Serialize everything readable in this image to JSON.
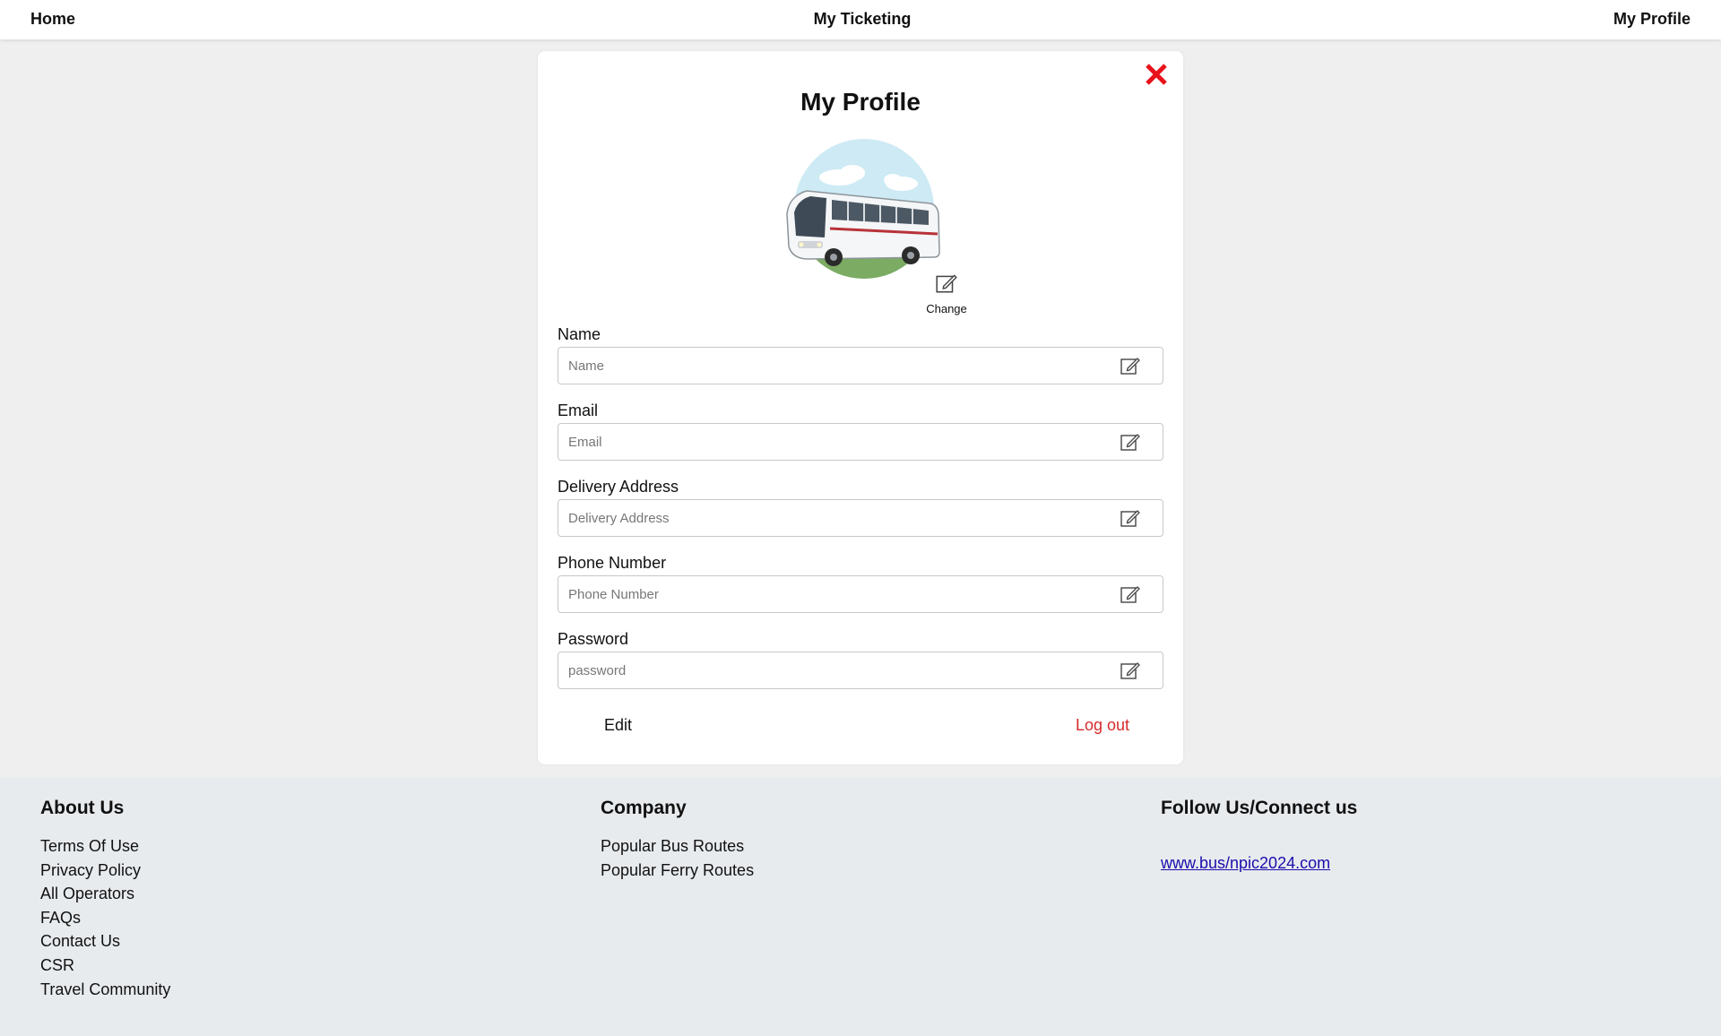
{
  "nav": {
    "home": "Home",
    "ticketing": "My Ticketing",
    "profile": "My Profile"
  },
  "card": {
    "title": "My Profile",
    "change_label": "Change",
    "fields": [
      {
        "label": "Name",
        "placeholder": "Name",
        "value": ""
      },
      {
        "label": "Email",
        "placeholder": "Email",
        "value": ""
      },
      {
        "label": "Delivery Address",
        "placeholder": "Delivery Address",
        "value": ""
      },
      {
        "label": "Phone Number",
        "placeholder": "Phone Number",
        "value": ""
      },
      {
        "label": "Password",
        "placeholder": "password",
        "value": ""
      }
    ],
    "edit_label": "Edit",
    "logout_label": "Log out"
  },
  "footer": {
    "about": {
      "heading": "About Us",
      "items": [
        "Terms Of Use",
        "Privacy Policy",
        "All Operators",
        "FAQs",
        "Contact Us",
        "CSR",
        "Travel Community"
      ]
    },
    "company": {
      "heading": "Company",
      "items": [
        "Popular Bus Routes",
        "Popular Ferry Routes"
      ]
    },
    "follow": {
      "heading": "Follow Us/Connect us",
      "link": "www.bus/npic2024.com"
    }
  },
  "colors": {
    "page_bg": "#efefef",
    "card_bg": "#ffffff",
    "footer_bg": "#e8ebee",
    "close_red": "#e8121b",
    "logout_red": "#d62b2b",
    "link_blue": "#1a0dab"
  },
  "icons": {
    "close": "close-icon",
    "avatar": "bus-avatar-image",
    "edit": "edit-pencil-icon"
  }
}
